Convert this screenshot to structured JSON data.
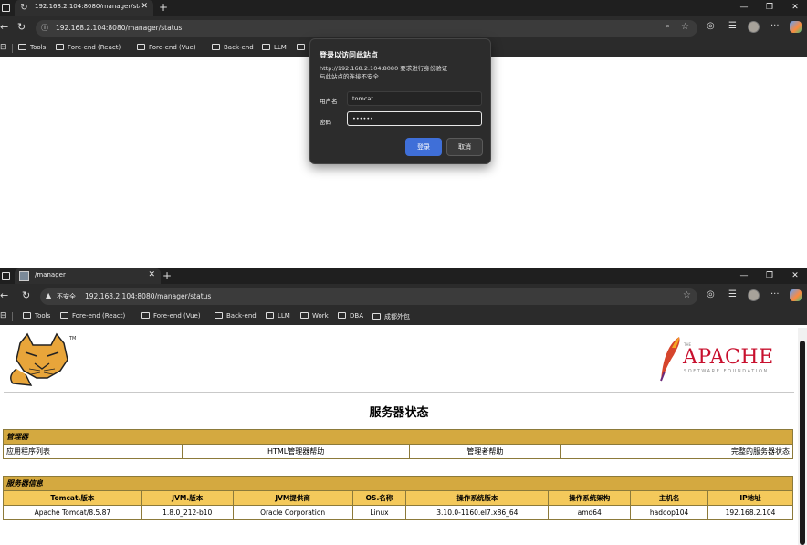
{
  "window1": {
    "tab_title": "192.168.2.104:8080/manager/stat",
    "url": "192.168.2.104:8080/manager/status",
    "bookmarks": [
      "Tools",
      "Fore-end (React)",
      "Fore-end (Vue)",
      "Back-end",
      "LLM"
    ],
    "dialog": {
      "title": "登录以访问此站点",
      "description_line1": "http://192.168.2.104:8080 要求进行身份验证",
      "description_line2": "与此站点的连接不安全",
      "username_label": "用户名",
      "username_value": "tomcat",
      "password_label": "密码",
      "password_value": "••••••",
      "ok_label": "登录",
      "cancel_label": "取消"
    }
  },
  "window2": {
    "tab_title": "/manager",
    "security_label": "不安全",
    "url": "192.168.2.104:8080/manager/status",
    "bookmarks": [
      "Tools",
      "Fore-end (React)",
      "Fore-end (Vue)",
      "Back-end",
      "LLM",
      "Work",
      "DBA",
      "成都外包"
    ]
  },
  "page": {
    "apache_text": "APACHE",
    "apache_the": "THE",
    "apache_sub": "SOFTWARE FOUNDATION",
    "title": "服务器状态",
    "manager_header": "管理器",
    "manager_links": [
      "应用程序列表",
      "HTML管理器帮助",
      "管理者帮助",
      "完整的服务器状态"
    ],
    "server_info_header": "服务器信息",
    "server_info_columns": [
      "Tomcat.版本",
      "JVM.版本",
      "JVM提供商",
      "OS.名称",
      "操作系统版本",
      "操作系统架构",
      "主机名",
      "IP地址"
    ],
    "server_info_values": [
      "Apache Tomcat/8.5.87",
      "1.8.0_212-b10",
      "Oracle Corporation",
      "Linux",
      "3.10.0-1160.el7.x86_64",
      "amd64",
      "hadoop104",
      "192.168.2.104"
    ]
  },
  "colors": {
    "section_header": "#d4a940",
    "column_header": "#f4c95b",
    "dialog_button": "#3f6fd8",
    "apache_red": "#c8102e"
  }
}
